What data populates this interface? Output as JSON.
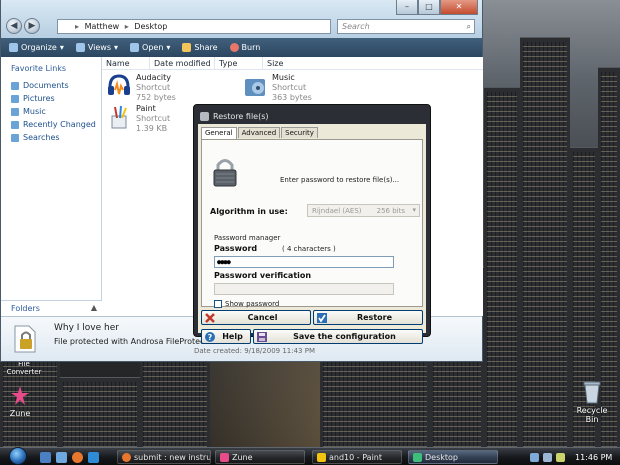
{
  "explorer": {
    "address": {
      "parts": [
        "Matthew",
        "Desktop"
      ],
      "separator": "▸"
    },
    "search_placeholder": "Search",
    "toolbar": {
      "organize": "Organize",
      "views": "Views",
      "open": "Open",
      "share": "Share",
      "burn": "Burn"
    },
    "sidebar": {
      "title": "Favorite Links",
      "items": [
        "Documents",
        "Pictures",
        "Music",
        "Recently Changed",
        "Searches"
      ],
      "folders_label": "Folders"
    },
    "columns": [
      "Name",
      "Date modified",
      "Type",
      "Size"
    ],
    "files": [
      {
        "name": "Audacity",
        "type": "Shortcut",
        "size": "752 bytes"
      },
      {
        "name": "Music",
        "type": "Shortcut",
        "size": "363 bytes"
      },
      {
        "name": "Paint",
        "type": "Shortcut",
        "size": "1.39 KB"
      }
    ],
    "details": {
      "title": "Why I love her",
      "subtitle": "File protected with Androsa FileProtector",
      "date": "Date created: 9/18/2009 11:43 PM"
    }
  },
  "dialog": {
    "title": "Restore file(s)",
    "tabs": [
      "General",
      "Advanced",
      "Security"
    ],
    "prompt": "Enter password to restore file(s)...",
    "algorithm_label": "Algorithm in use:",
    "algorithm_value": "Rijndael (AES)",
    "algorithm_bits": "256 bits",
    "password_manager_label": "Password manager",
    "password_label": "Password",
    "password_hint": "( 4 characters )",
    "password_value": "●●●●",
    "verification_label": "Password verification",
    "show_password_label": "Show password",
    "buttons": {
      "cancel": "Cancel",
      "restore": "Restore",
      "help": "Help",
      "save": "Save the configuration"
    }
  },
  "desktop": {
    "file_converter_label": "File Converter",
    "zune_label": "Zune",
    "recycle_label": "Recycle Bin"
  },
  "taskbar": {
    "tasks": [
      "submit : new instruc...",
      "Zune",
      "and10 - Paint",
      "Desktop"
    ],
    "clock": "11:46 PM"
  },
  "colors": {
    "accent": "#1e4f8c",
    "dialog_frame": "#2b2f35",
    "cancel_red": "#c0392b",
    "restore_blue": "#2a6fb5"
  }
}
